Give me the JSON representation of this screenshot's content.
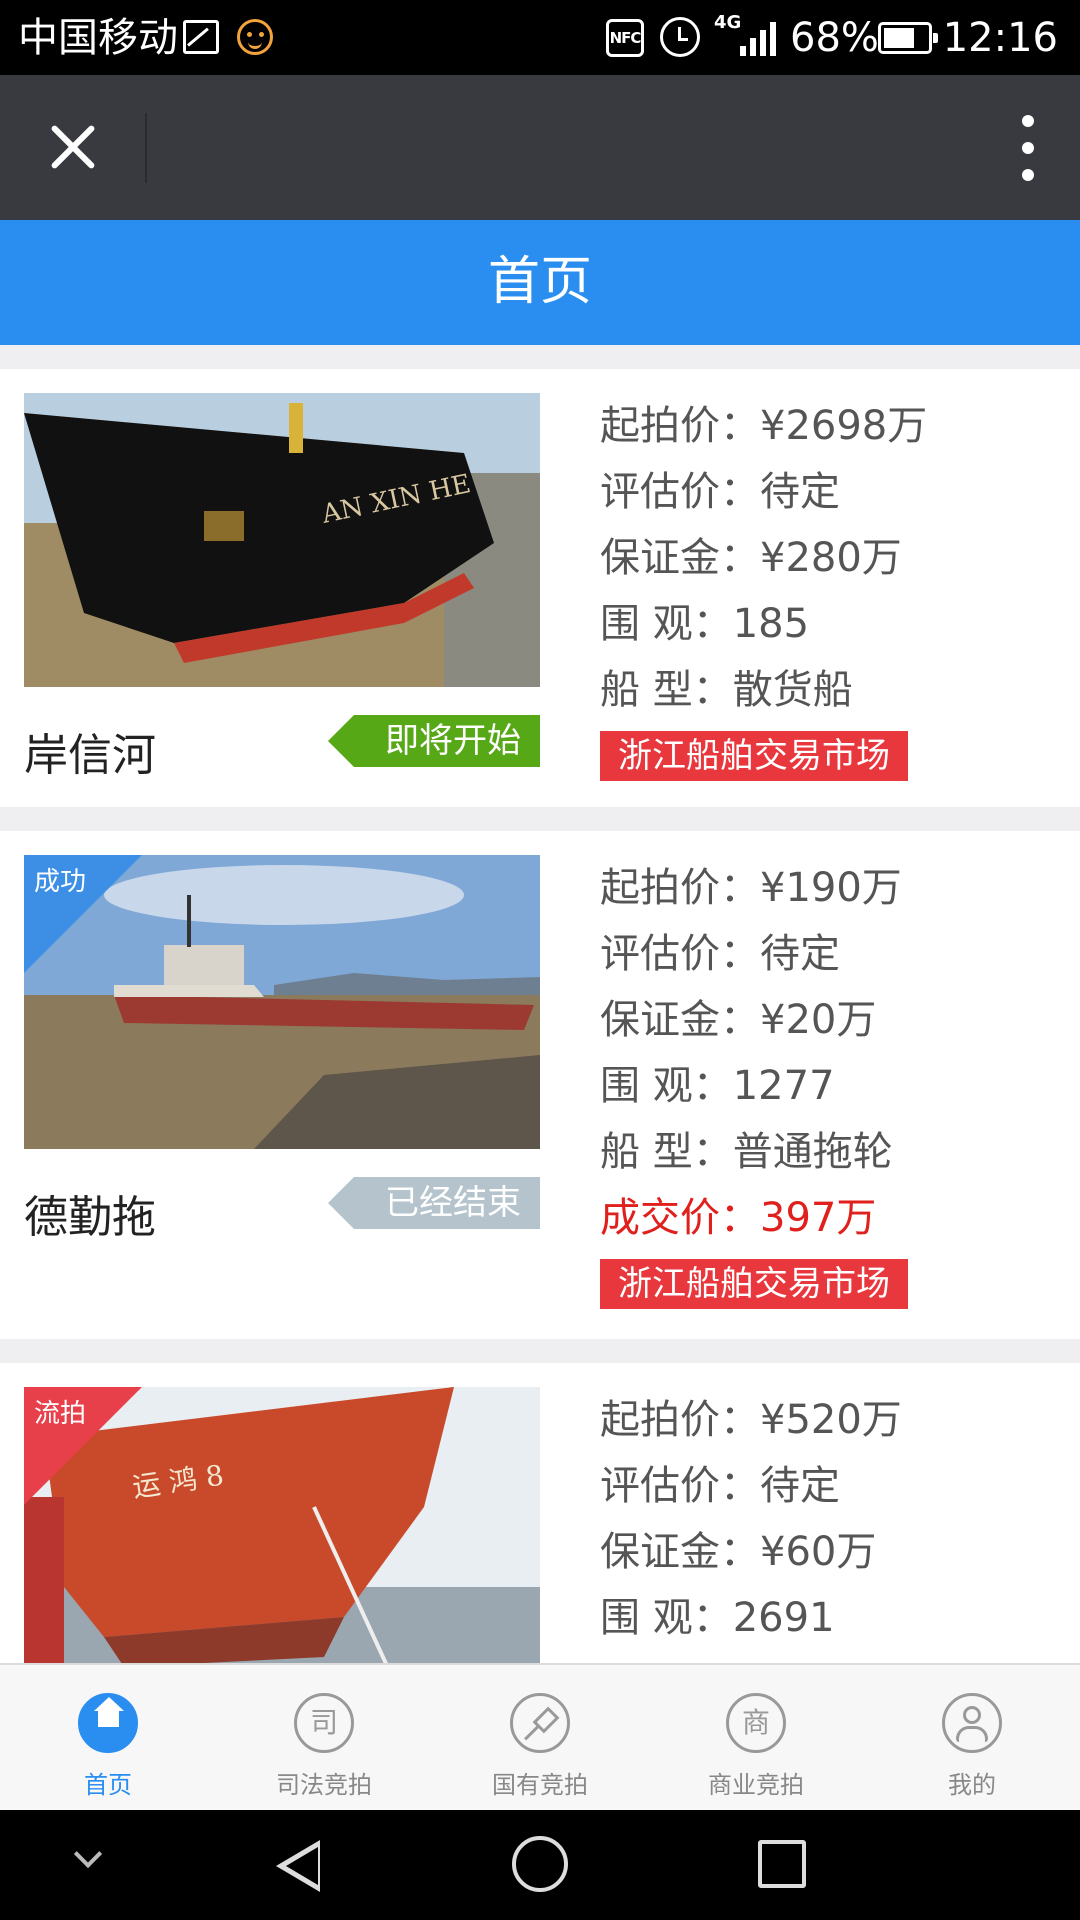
{
  "status_bar": {
    "carrier": "中国移动",
    "nfc": "NFC",
    "network": "4G",
    "battery": "68%",
    "time": "12:16"
  },
  "header": {
    "title": "首页"
  },
  "listings": [
    {
      "name": "岸信河",
      "status": "即将开始",
      "corner_label": "",
      "start_price_label": "起拍价：",
      "start_price": "¥2698万",
      "appraisal_label": "评估价：",
      "appraisal": "待定",
      "deposit_label": "保证金：",
      "deposit": "¥280万",
      "views_label": "围 观：",
      "views": "185",
      "type_label": "船 型：",
      "ship_type": "散货船",
      "market": "浙江船舶交易市场"
    },
    {
      "name": "德勤拖",
      "status": "已经结束",
      "corner_label": "成功",
      "start_price_label": "起拍价：",
      "start_price": "¥190万",
      "appraisal_label": "评估价：",
      "appraisal": "待定",
      "deposit_label": "保证金：",
      "deposit": "¥20万",
      "views_label": "围 观：",
      "views": "1277",
      "type_label": "船 型：",
      "ship_type": "普通拖轮",
      "deal_label": "成交价：",
      "deal_price": "397万",
      "market": "浙江船舶交易市场"
    },
    {
      "name": "",
      "status": "",
      "corner_label": "流拍",
      "start_price_label": "起拍价：",
      "start_price": "¥520万",
      "appraisal_label": "评估价：",
      "appraisal": "待定",
      "deposit_label": "保证金：",
      "deposit": "¥60万",
      "views_label": "围 观：",
      "views": "2691"
    }
  ],
  "tabs": [
    {
      "label": "首页",
      "icon": "home-icon",
      "glyph": "",
      "active": true
    },
    {
      "label": "司法竞拍",
      "icon": "judicial-icon",
      "glyph": "司"
    },
    {
      "label": "国有竞拍",
      "icon": "gavel-icon",
      "glyph": ""
    },
    {
      "label": "商业竞拍",
      "icon": "commerce-icon",
      "glyph": "商"
    },
    {
      "label": "我的",
      "icon": "user-icon",
      "glyph": ""
    }
  ],
  "colors": {
    "header_blue": "#2a8ef0",
    "titlebar": "#393a3f",
    "status_upcoming": "#56a817",
    "status_ended": "#b4c3cc",
    "market_tag": "#e8383d",
    "deal_price": "#e0201c"
  }
}
